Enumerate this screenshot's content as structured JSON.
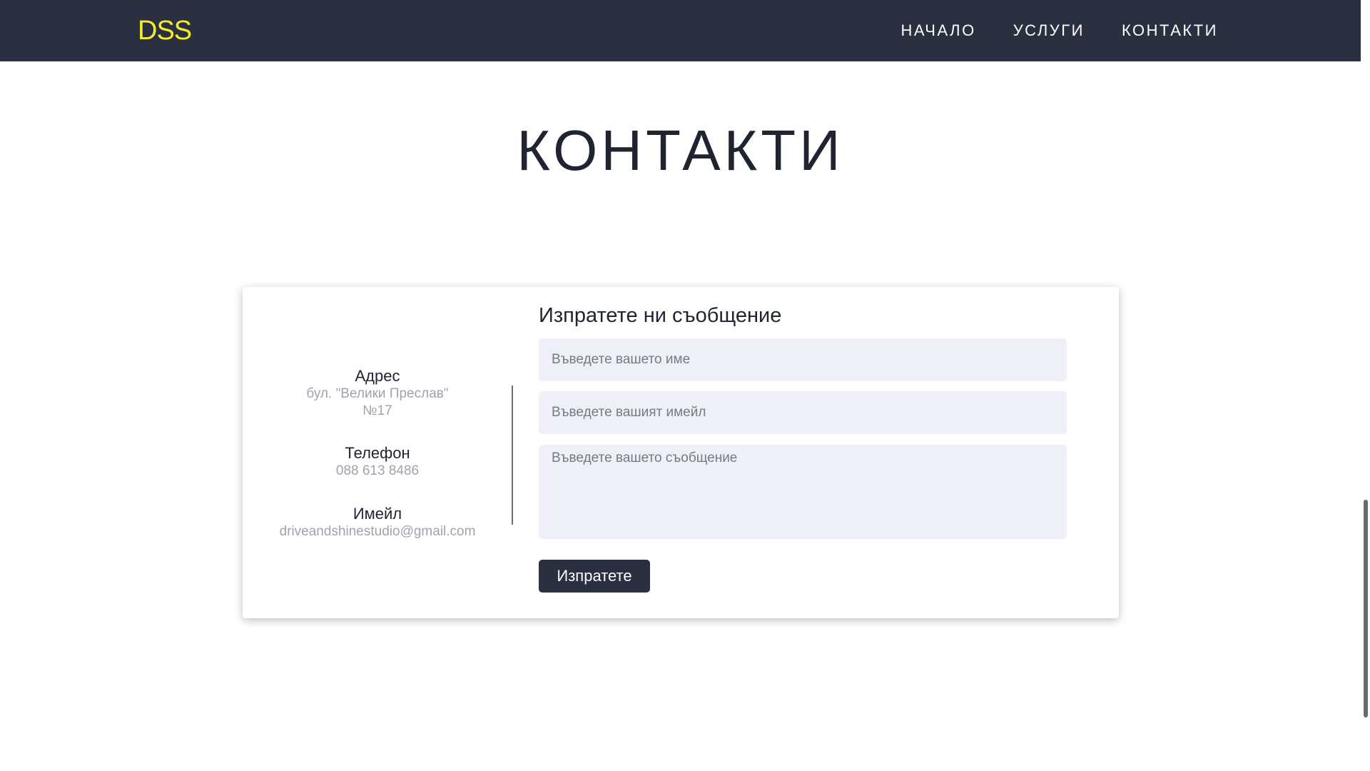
{
  "navbar": {
    "logo": "DSS",
    "links": [
      {
        "label": "НАЧАЛО"
      },
      {
        "label": "УСЛУГИ"
      },
      {
        "label": "КОНТАКТИ"
      }
    ]
  },
  "page": {
    "title": "КОНТАКТИ"
  },
  "contact_info": {
    "address": {
      "label": "Адрес",
      "line1": "бул. \"Велики Преслав\"",
      "line2": "№17"
    },
    "phone": {
      "label": "Телефон",
      "value": "088 613 8486"
    },
    "email": {
      "label": "Имейл",
      "value": "driveandshinestudio@gmail.com"
    }
  },
  "form": {
    "title": "Изпратете ни съобщение",
    "name_placeholder": "Въведете вашето име",
    "email_placeholder": "Въведете вашият имейл",
    "message_placeholder": "Въведете вашето съобщение",
    "submit_label": "Изпратете"
  },
  "colors": {
    "navbar_bg": "#2a3040",
    "logo": "#f6ec2b",
    "field_bg": "#eff0f7",
    "button_bg": "#2a3040"
  }
}
